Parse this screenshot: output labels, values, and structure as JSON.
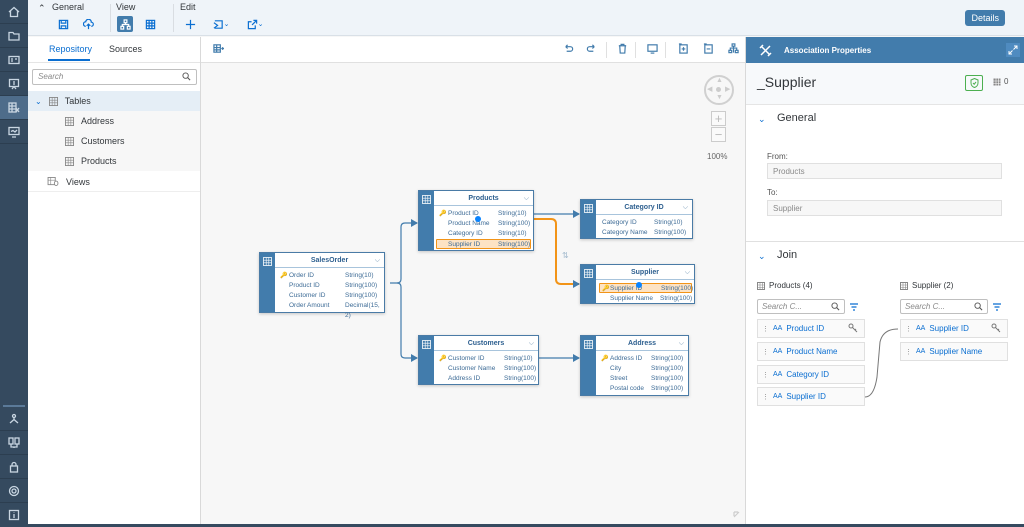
{
  "toolbar": {
    "groups": [
      {
        "label": "General",
        "collapse_icon": "chevron-up-icon",
        "items": [
          "save-icon",
          "upload-icon"
        ]
      },
      {
        "label": "View",
        "items": [
          "diagram-view-icon",
          "table-view-icon"
        ],
        "active": "diagram-view-icon"
      },
      {
        "label": "Edit",
        "items": [
          "add-icon",
          "import-icon",
          "export-icon"
        ]
      }
    ],
    "details_label": "Details"
  },
  "shell_bar": {
    "top_items": [
      "home-icon",
      "folder-icon",
      "id-card-icon",
      "presentation-icon",
      "data-builder-icon",
      "monitor-icon"
    ],
    "active": "data-builder-icon",
    "bottom_items": [
      "network-icon",
      "connections-icon",
      "lock-icon",
      "settings-icon",
      "info-icon"
    ]
  },
  "left_panel": {
    "tabs": [
      {
        "label": "Repository",
        "active": true
      },
      {
        "label": "Sources",
        "active": false
      }
    ],
    "search_placeholder": "Search",
    "tree": [
      {
        "label": "Tables",
        "expanded": true,
        "children": [
          "Address",
          "Customers",
          "Products"
        ]
      },
      {
        "label": "Views"
      }
    ]
  },
  "canvas": {
    "zoom_level": "100%",
    "entities": {
      "salesorder": {
        "title": "SalesOrder",
        "rows": [
          {
            "name": "Order ID",
            "type": "String(10)",
            "key": true
          },
          {
            "name": "Product ID",
            "type": "String(100)"
          },
          {
            "name": "Customer ID",
            "type": "String(100)"
          },
          {
            "name": "Order Amount",
            "type": "Decimal(15, 2)"
          }
        ]
      },
      "products": {
        "title": "Products",
        "rows": [
          {
            "name": "Product ID",
            "type": "String(10)",
            "key": true
          },
          {
            "name": "Product Name",
            "type": "String(100)"
          },
          {
            "name": "Category ID",
            "type": "String(10)"
          },
          {
            "name": "Supplier ID",
            "type": "String(100)",
            "highlighted": true
          }
        ]
      },
      "category": {
        "title": "Category ID",
        "rows": [
          {
            "name": "Category ID",
            "type": "String(10)"
          },
          {
            "name": "Category Name",
            "type": "String(100)"
          }
        ]
      },
      "supplier": {
        "title": "Supplier",
        "rows": [
          {
            "name": "Supplier ID",
            "type": "String(100)",
            "key": true,
            "highlighted": true
          },
          {
            "name": "Supplier Name",
            "type": "String(100)"
          }
        ]
      },
      "customers": {
        "title": "Customers",
        "rows": [
          {
            "name": "Customer ID",
            "type": "String(10)",
            "key": true
          },
          {
            "name": "Customer Name",
            "type": "String(100)"
          },
          {
            "name": "Address ID",
            "type": "String(100)"
          }
        ]
      },
      "address": {
        "title": "Address",
        "rows": [
          {
            "name": "Address ID",
            "type": "String(100)",
            "key": true
          },
          {
            "name": "City",
            "type": "String(100)"
          },
          {
            "name": "Street",
            "type": "String(100)"
          },
          {
            "name": "Postal code",
            "type": "String(100)"
          }
        ]
      }
    }
  },
  "right_panel": {
    "header": "Association Properties",
    "name": "_Supplier",
    "count": "0",
    "general": {
      "title": "General",
      "from_label": "From:",
      "from_value": "Products",
      "to_label": "To:",
      "to_value": "Supplier"
    },
    "join": {
      "title": "Join",
      "left": {
        "title": "Products (4)",
        "search_placeholder": "Search C...",
        "items": [
          {
            "label": "Product ID",
            "key": true
          },
          {
            "label": "Product Name"
          },
          {
            "label": "Category ID"
          },
          {
            "label": "Supplier ID"
          }
        ]
      },
      "right": {
        "title": "Supplier (2)",
        "search_placeholder": "Search C...",
        "items": [
          {
            "label": "Supplier ID",
            "key": true
          },
          {
            "label": "Supplier Name"
          }
        ]
      }
    }
  },
  "colors": {
    "accent": "#427cac",
    "shell": "#354a5f",
    "highlight": "#f29418",
    "link": "#0a6ed1"
  }
}
